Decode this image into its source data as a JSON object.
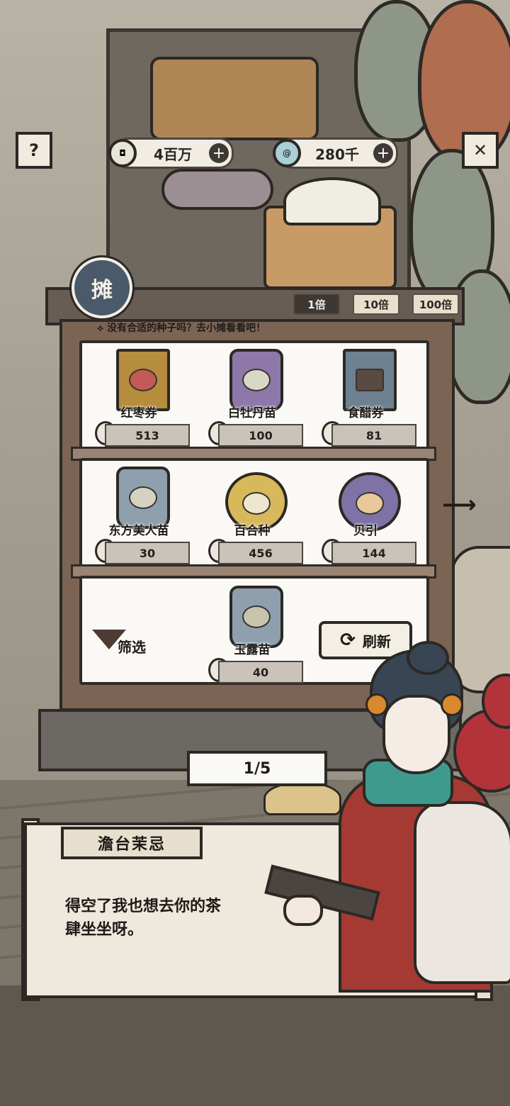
{
  "hud": {
    "help_icon": "question-mark",
    "close_icon": "x-mark",
    "currencies": [
      {
        "icon": "copper-coin",
        "amount": "4百万"
      },
      {
        "icon": "jade-swirl",
        "amount": "280千"
      }
    ]
  },
  "stall": {
    "badge_text": "摊",
    "hint": "没有合适的种子吗？去小摊看看吧！",
    "multipliers": [
      {
        "label": "1倍",
        "active": true
      },
      {
        "label": "10倍",
        "active": false
      },
      {
        "label": "100倍",
        "active": false
      }
    ]
  },
  "shelves": [
    [
      {
        "name": "红枣券",
        "price": "513",
        "type": "card",
        "color": "#b68d3d"
      },
      {
        "name": "白牡丹苗",
        "price": "100",
        "type": "bag",
        "color": "#8d78a9"
      },
      {
        "name": "食醋券",
        "price": "81",
        "type": "card",
        "color": "#6d8190"
      }
    ],
    [
      {
        "name": "东方美人苗",
        "price": "30",
        "type": "bag",
        "color": "#8ea0ad"
      },
      {
        "name": "百合种",
        "price": "456",
        "type": "pouch",
        "color": "#d7b85a"
      },
      {
        "name": "贝引",
        "price": "144",
        "type": "pouch",
        "color": "#7e72a6"
      }
    ],
    [
      {
        "name": "玉露苗",
        "price": "40",
        "type": "bag",
        "color": "#8ea0ad"
      }
    ]
  ],
  "controls": {
    "filter_label": "筛选",
    "refresh_label": "刷新",
    "page": "1/5"
  },
  "dialog": {
    "speaker": "澹台茉忌",
    "text_line1": "得空了我也想去你的茶",
    "text_line2": "肆坐坐呀。"
  }
}
